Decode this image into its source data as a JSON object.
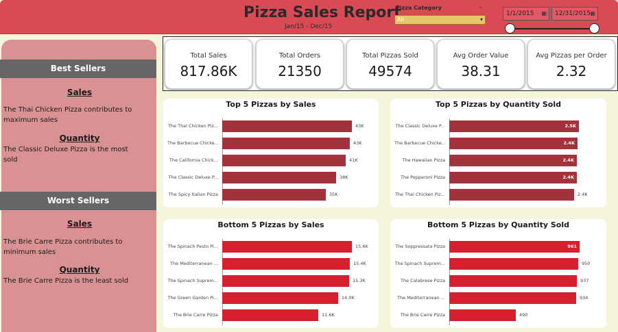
{
  "header": {
    "title": "Pizza Sales Report",
    "subtitle": "Jan/15 - Dec/15",
    "category_label": "Pizza Category",
    "category_value": "All",
    "start_date": "1/1/2015",
    "end_date": "12/31/2015",
    "background": "#d94a55"
  },
  "sidebar": {
    "best_title": "Best Sellers",
    "best_sales_head": "Sales",
    "best_sales_text": "The Thai Chicken Pizza contributes to maximum sales",
    "best_qty_head": "Quantity",
    "best_qty_text": "The Classic Deluxe Pizza is the most sold",
    "worst_title": "Worst Sellers",
    "worst_sales_head": "Sales",
    "worst_sales_text": "The Brie Carre Pizza contributes to minimum sales",
    "worst_qty_head": "Quantity",
    "worst_qty_text": "The Brie Carre Pizza is the least sold"
  },
  "kpis": [
    {
      "label": "Total Sales",
      "value": "817.86K"
    },
    {
      "label": "Total Orders",
      "value": "21350"
    },
    {
      "label": "Total Pizzas Sold",
      "value": "49574"
    },
    {
      "label": "Avg Order Value",
      "value": "38.31"
    },
    {
      "label": "Avg Pizzas per Order",
      "value": "2.32"
    }
  ],
  "chart_data": [
    {
      "type": "bar",
      "title": "Top 5 Pizzas by Sales",
      "color": "#a3323c",
      "categories": [
        "The Thai Chicken Piz...",
        "The Barbecue Chicke...",
        "The California Chick...",
        "The Classic Deluxe P...",
        "The Spicy Italian Pizza"
      ],
      "values": [
        43434,
        42768,
        41410,
        38180,
        34831
      ],
      "labels": [
        "43K",
        "43K",
        "41K",
        "38K",
        "35K"
      ],
      "label_inside": [
        false,
        false,
        false,
        false,
        false
      ],
      "xlim": [
        0,
        46000
      ]
    },
    {
      "type": "bar",
      "title": "Top 5 Pizzas by Quantity Sold",
      "color": "#a3323c",
      "categories": [
        "The Classic Deluxe P...",
        "The Barbecue Chicke...",
        "The Hawaiian Pizza",
        "The Pepperoni Pizza",
        "The Thai Chicken Piz..."
      ],
      "values": [
        2453,
        2432,
        2422,
        2418,
        2371
      ],
      "labels": [
        "2.5K",
        "2.4K",
        "2.4K",
        "2.4K",
        "2.4K"
      ],
      "label_inside": [
        true,
        true,
        true,
        true,
        false
      ],
      "xlim": [
        0,
        2600
      ]
    },
    {
      "type": "bar",
      "title": "Bottom 5 Pizzas by Sales",
      "color": "#d81f2e",
      "categories": [
        "The Spinach Pesto Pi...",
        "The Mediterranean ...",
        "The Spinach Suprem...",
        "The Green Garden Pi...",
        "The Brie Carre Pizza"
      ],
      "values": [
        15596,
        15360,
        15278,
        13956,
        11588
      ],
      "labels": [
        "15.6K",
        "15.4K",
        "15.3K",
        "14.0K",
        "11.6K"
      ],
      "label_inside": [
        false,
        false,
        false,
        false,
        false
      ],
      "xlim": [
        0,
        16500
      ]
    },
    {
      "type": "bar",
      "title": "Bottom 5 Pizzas by Quantity Sold",
      "color": "#d81f2e",
      "categories": [
        "The Soppressata Pizza",
        "The Spinach Suprem...",
        "The Calabrese Pizza",
        "The Mediterranean ...",
        "The Brie Carre Pizza"
      ],
      "values": [
        961,
        950,
        937,
        934,
        490
      ],
      "labels": [
        "961",
        "950",
        "937",
        "934",
        "490"
      ],
      "label_inside": [
        true,
        false,
        false,
        false,
        false
      ],
      "xlim": [
        0,
        1010
      ]
    }
  ]
}
